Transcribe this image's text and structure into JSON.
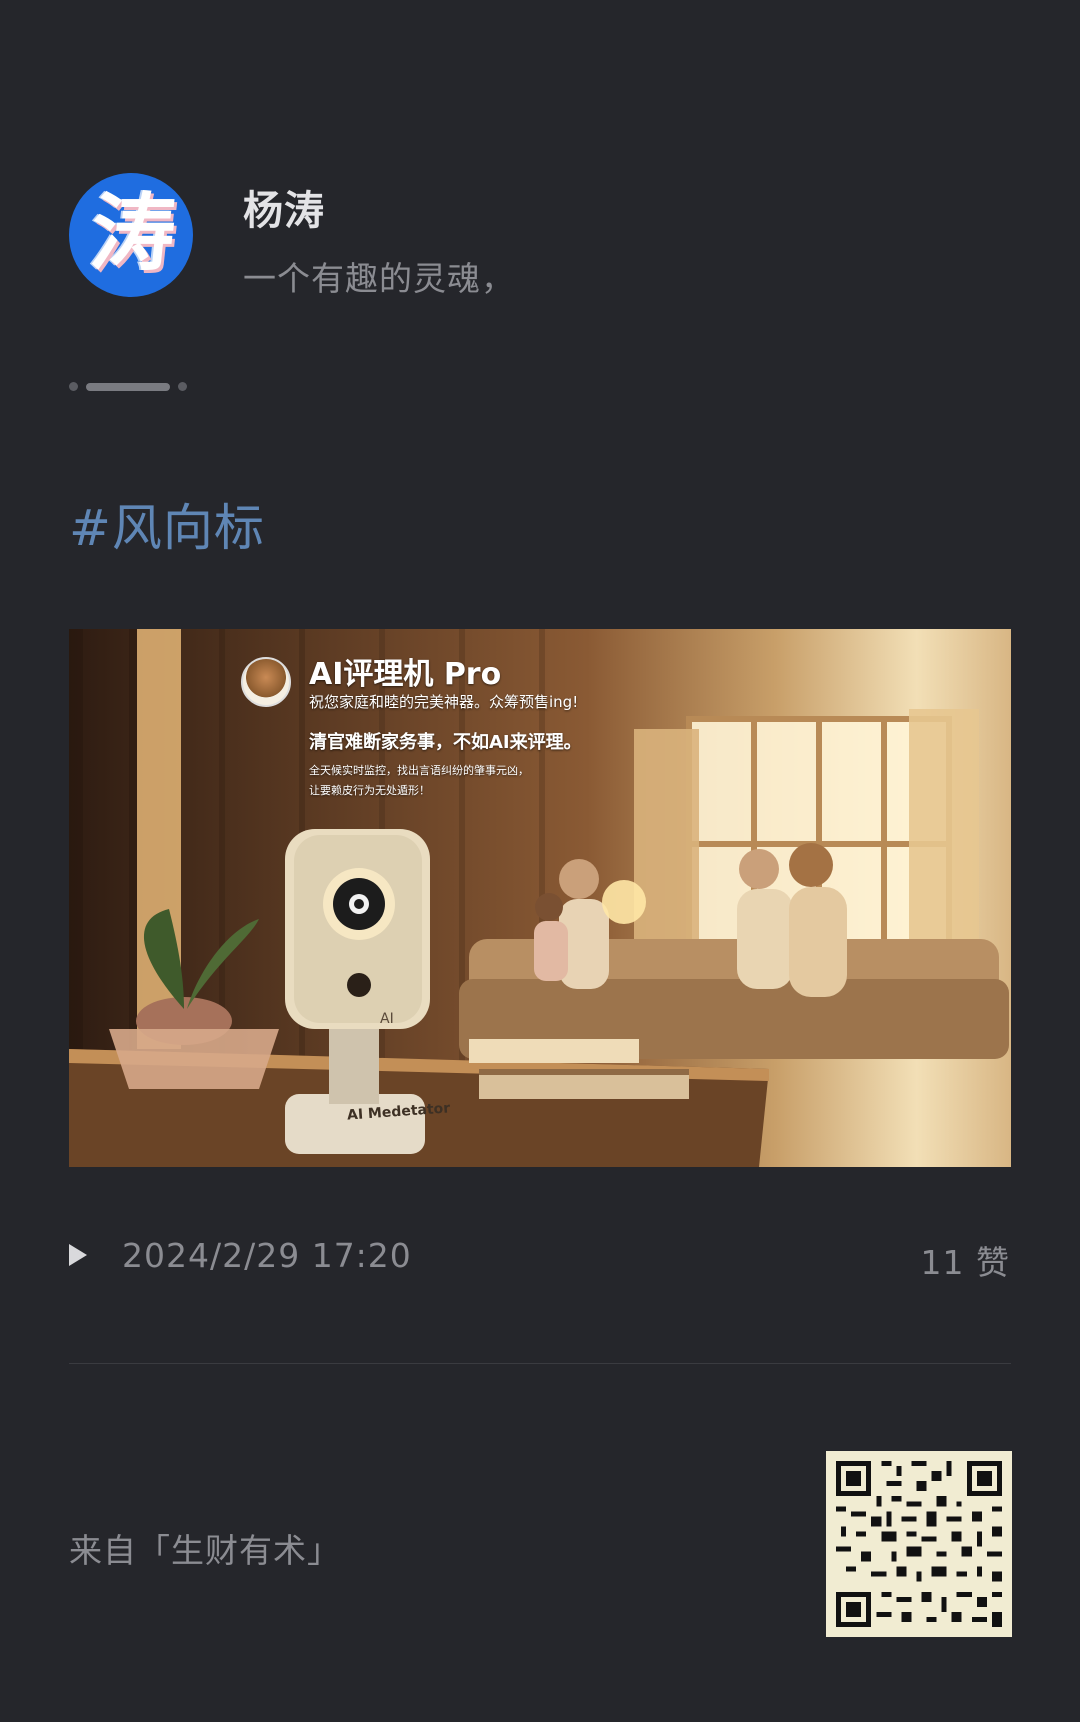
{
  "author": {
    "avatar_char": "涛",
    "name": "杨涛",
    "bio": "一个有趣的灵魂，"
  },
  "post": {
    "hashtag": "#风向标",
    "image": {
      "title": "AI评理机 Pro",
      "line1": "祝您家庭和睦的完美神器。众筹预售ing!",
      "line2": "清官难断家务事，不如AI来评理。",
      "line3": "全天候实时监控，找出言语纠纷的肇事元凶，",
      "line4": "让要赖皮行为无处遁形！",
      "device_label": "AI",
      "base_label": "AI Medetator"
    },
    "timestamp": "2024/2/29 17:20",
    "likes": "11 赞"
  },
  "footer": {
    "source": "来自「生财有术」"
  },
  "icons": {
    "play": "play-icon",
    "qr": "qr-code"
  },
  "colors": {
    "background": "#25262b",
    "hashtag": "#5f86b5",
    "avatar_bg": "#1f6de0"
  }
}
